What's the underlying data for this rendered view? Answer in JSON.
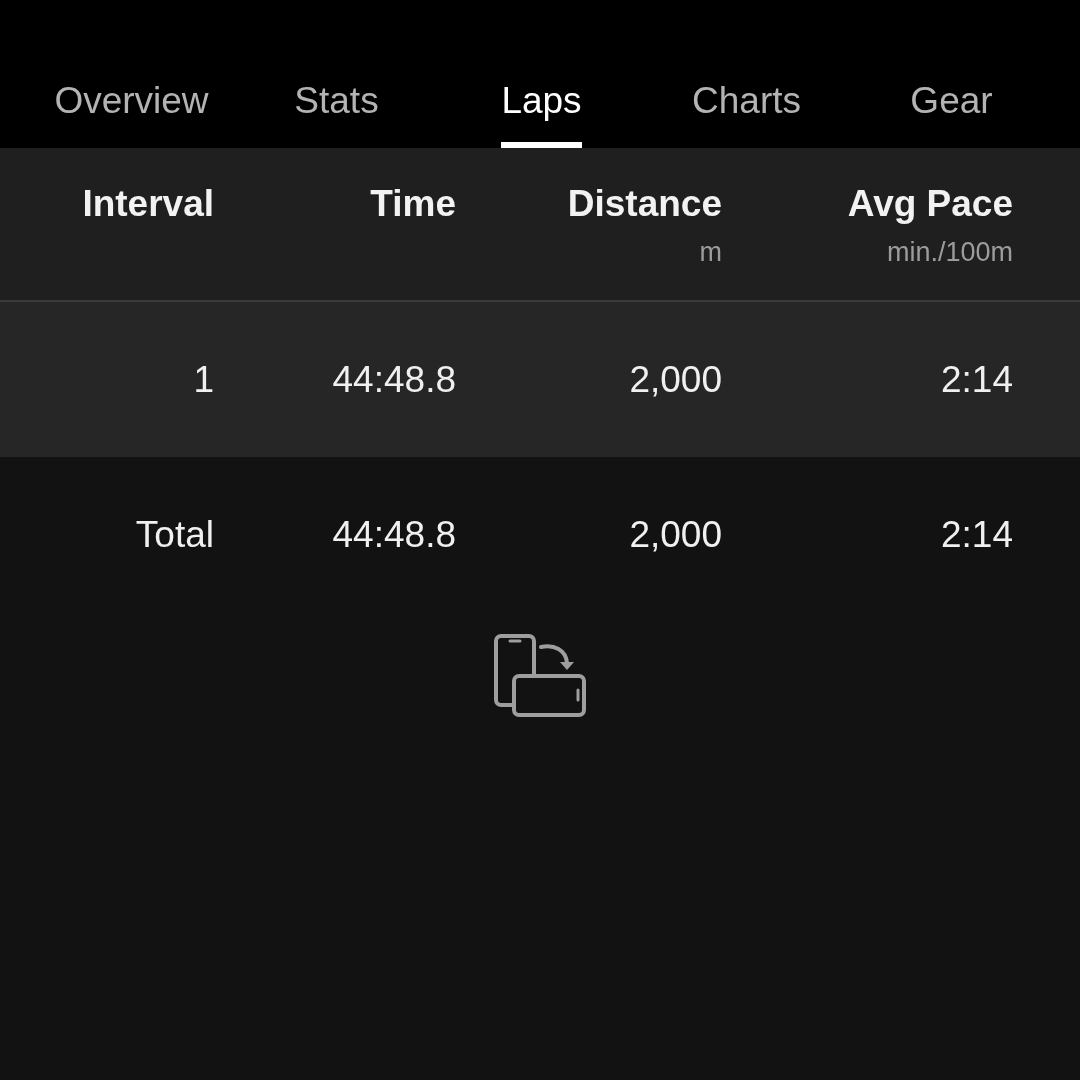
{
  "tabs": [
    {
      "label": "Overview",
      "selected": false
    },
    {
      "label": "Stats",
      "selected": false
    },
    {
      "label": "Laps",
      "selected": true
    },
    {
      "label": "Charts",
      "selected": false
    },
    {
      "label": "Gear",
      "selected": false
    }
  ],
  "table": {
    "columns": [
      {
        "label": "Interval"
      },
      {
        "label": "Time"
      },
      {
        "label": "Distance",
        "unit": "m"
      },
      {
        "label": "Avg Pace",
        "unit": "min./100m"
      }
    ],
    "rows": [
      {
        "kind": "lap",
        "cells": [
          "1",
          "44:48.8",
          "2,000",
          "2:14"
        ]
      },
      {
        "kind": "total",
        "cells": [
          "Total",
          "44:48.8",
          "2,000",
          "2:14"
        ]
      }
    ]
  }
}
